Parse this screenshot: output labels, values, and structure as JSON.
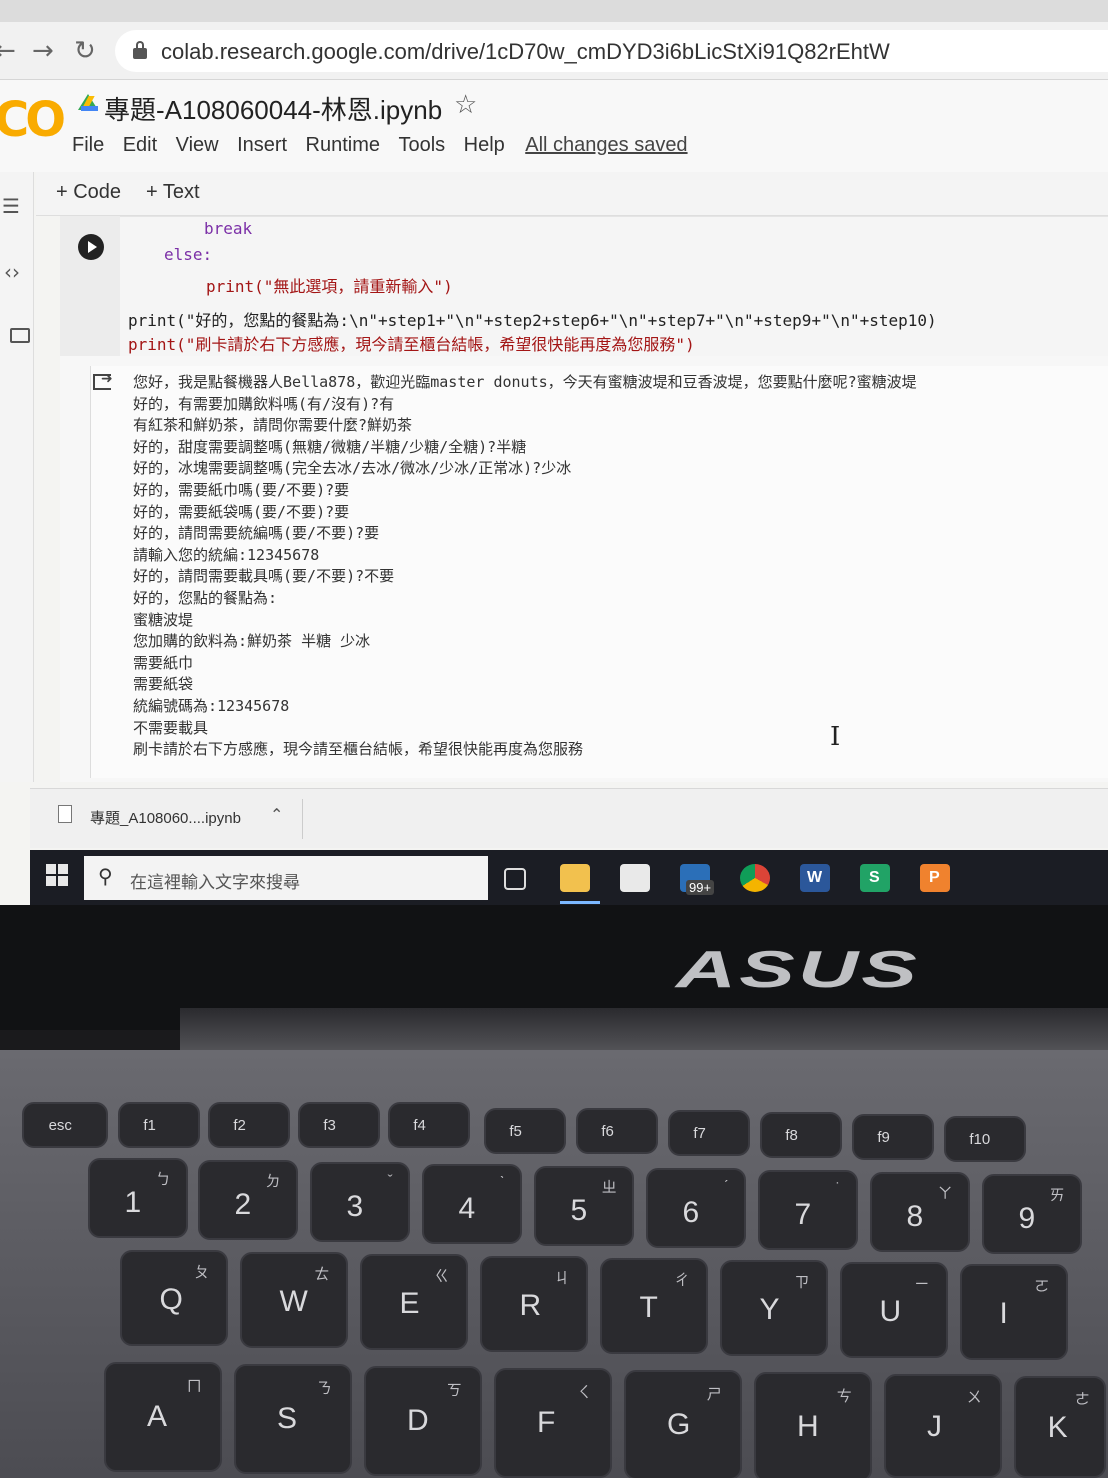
{
  "browser": {
    "url": "colab.research.google.com/drive/1cD70w_cmDYD3i6bLicStXi91Q82rEhtW"
  },
  "colab": {
    "logo": "CO",
    "notebook_title": "專題-A108060044-林恩.ipynb",
    "menu": [
      "File",
      "Edit",
      "View",
      "Insert",
      "Runtime",
      "Tools",
      "Help"
    ],
    "save_status": "All changes saved",
    "toolbar": {
      "add_code": "+ Code",
      "add_text": "+ Text"
    }
  },
  "code": {
    "lines": [
      "break",
      "else:",
      "print(\"無此選項，請重新輸入\")",
      "print(\"好的，您點的餐點為:\\n\"+step1+\"\\n\"+step2+step6+\"\\n\"+step7+\"\\n\"+step9+\"\\n\"+step10)",
      "print(\"刷卡請於右下方感應，現今請至櫃台結帳，希望很快能再度為您服務\")"
    ]
  },
  "output": {
    "lines": [
      "您好，我是點餐機器人Bella878，歡迎光臨master donuts，今天有蜜糖波堤和豆香波堤，您要點什麼呢?蜜糖波堤",
      "好的，有需要加購飲料嗎(有/沒有)?有",
      "有紅茶和鮮奶茶，請問你需要什麼?鮮奶茶",
      "好的，甜度需要調整嗎(無糖/微糖/半糖/少糖/全糖)?半糖",
      "好的，冰塊需要調整嗎(完全去冰/去冰/微冰/少冰/正常冰)?少冰",
      "好的，需要紙巾嗎(要/不要)?要",
      "好的，需要紙袋嗎(要/不要)?要",
      "好的，請問需要統編嗎(要/不要)?要",
      "請輸入您的統編:12345678",
      "好的，請問需要載具嗎(要/不要)?不要",
      "好的，您點的餐點為:",
      "蜜糖波堤",
      "您加購的飲料為:鮮奶茶 半糖 少冰",
      "需要紙巾",
      "需要紙袋",
      "統編號碼為:12345678",
      "不需要載具",
      "刷卡請於右下方感應，現今請至櫃台結帳，希望很快能再度為您服務"
    ]
  },
  "downloads": {
    "file_name": "專題_A108060....ipynb"
  },
  "taskbar": {
    "search_placeholder": "在這裡輸入文字來搜尋",
    "mail_badge": "99+",
    "apps": [
      "task-view",
      "file-explorer",
      "store",
      "mail",
      "chrome",
      "word",
      "sheets",
      "powerpoint"
    ]
  },
  "hardware": {
    "brand": "ASUS",
    "fn_keys": [
      "esc",
      "f1",
      "f2",
      "f3",
      "f4",
      "f5",
      "f6",
      "f7",
      "f8",
      "f9",
      "f10"
    ],
    "number_row": [
      {
        "main": "1",
        "sub": "ㄅ"
      },
      {
        "main": "2",
        "sub": "ㄉ"
      },
      {
        "main": "3",
        "sub": "ˇ"
      },
      {
        "main": "4",
        "sub": "ˋ"
      },
      {
        "main": "5",
        "sub": "ㄓ"
      },
      {
        "main": "6",
        "sub": "ˊ"
      },
      {
        "main": "7",
        "sub": "˙"
      },
      {
        "main": "8",
        "sub": "ㄚ"
      },
      {
        "main": "9",
        "sub": "ㄞ"
      }
    ],
    "q_row": [
      {
        "main": "Q",
        "sub": "ㄆ"
      },
      {
        "main": "W",
        "sub": "ㄊ"
      },
      {
        "main": "E",
        "sub": "ㄍ"
      },
      {
        "main": "R",
        "sub": "ㄐ"
      },
      {
        "main": "T",
        "sub": "ㄔ"
      },
      {
        "main": "Y",
        "sub": "ㄗ"
      },
      {
        "main": "U",
        "sub": "ㄧ"
      },
      {
        "main": "I",
        "sub": "ㄛ"
      }
    ],
    "a_row": [
      {
        "main": "A",
        "sub": "ㄇ"
      },
      {
        "main": "S",
        "sub": "ㄋ"
      },
      {
        "main": "D",
        "sub": "ㄎ"
      },
      {
        "main": "F",
        "sub": "ㄑ"
      },
      {
        "main": "G",
        "sub": "ㄕ"
      },
      {
        "main": "H",
        "sub": "ㄘ"
      },
      {
        "main": "J",
        "sub": "ㄨ"
      },
      {
        "main": "K",
        "sub": "ㄜ"
      }
    ]
  },
  "colors": {
    "colab_orange": "#f9ab00",
    "taskbar": "#1b1d24",
    "code_keyword": "#7b2fa7",
    "code_string": "#a31515"
  }
}
